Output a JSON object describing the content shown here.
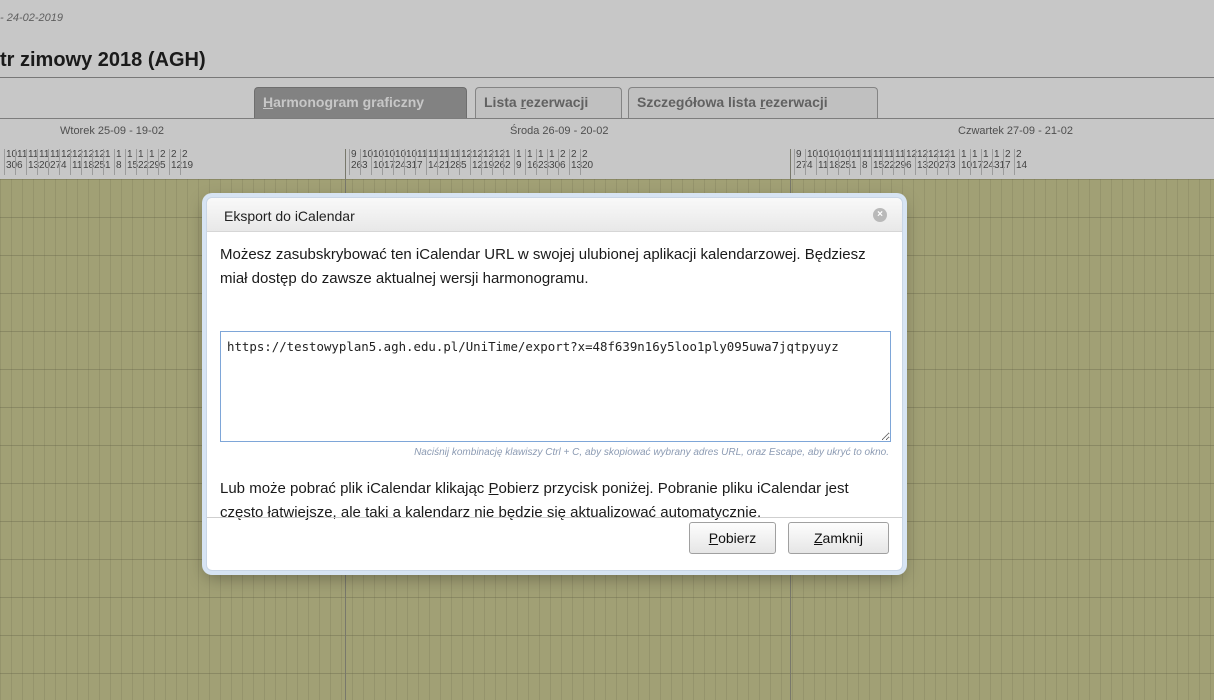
{
  "page": {
    "date_range": "- 24-02-2019",
    "title": "tr zimowy 2018 (AGH)"
  },
  "tabs": [
    {
      "accel": "H",
      "rest": "armonogram graficzny",
      "active": true
    },
    {
      "pre": "Lista ",
      "accel": "r",
      "rest": "ezerwacji",
      "active": false
    },
    {
      "pre": "Szczegółowa lista ",
      "accel": "r",
      "rest": "ezerwacji",
      "active": false
    }
  ],
  "calendar": {
    "days": [
      "Wtorek 25-09 - 19-02",
      "Środa 26-09 - 20-02",
      "Czwartek 27-09 - 21-02"
    ],
    "ticks": [
      [
        [
          "10",
          "30"
        ],
        [
          "11",
          "6"
        ],
        [
          "11",
          "13"
        ],
        [
          "11",
          "20"
        ],
        [
          "11",
          "27"
        ],
        [
          "12",
          "4"
        ],
        [
          "12",
          "11"
        ],
        [
          "12",
          "18"
        ],
        [
          "12",
          "25"
        ],
        [
          "1",
          "1"
        ],
        [
          "1",
          "8"
        ],
        [
          "1",
          "15"
        ],
        [
          "1",
          "22"
        ],
        [
          "1",
          "29"
        ],
        [
          "2",
          "5"
        ],
        [
          "2",
          "12"
        ],
        [
          "2",
          "19"
        ]
      ],
      [
        [
          "9",
          "26"
        ],
        [
          "10",
          "3"
        ],
        [
          "10",
          "10"
        ],
        [
          "10",
          "17"
        ],
        [
          "10",
          "24"
        ],
        [
          "10",
          "31"
        ],
        [
          "11",
          "7"
        ],
        [
          "11",
          "14"
        ],
        [
          "11",
          "21"
        ],
        [
          "11",
          "28"
        ],
        [
          "12",
          "5"
        ],
        [
          "12",
          "12"
        ],
        [
          "12",
          "19"
        ],
        [
          "12",
          "26"
        ],
        [
          "1",
          "2"
        ],
        [
          "1",
          "9"
        ],
        [
          "1",
          "16"
        ],
        [
          "1",
          "23"
        ],
        [
          "1",
          "30"
        ],
        [
          "2",
          "6"
        ],
        [
          "2",
          "13"
        ],
        [
          "2",
          "20"
        ]
      ],
      [
        [
          "9",
          "27"
        ],
        [
          "10",
          "4"
        ],
        [
          "10",
          "11"
        ],
        [
          "10",
          "18"
        ],
        [
          "10",
          "25"
        ],
        [
          "11",
          "1"
        ],
        [
          "11",
          "8"
        ],
        [
          "11",
          "15"
        ],
        [
          "11",
          "22"
        ],
        [
          "11",
          "29"
        ],
        [
          "12",
          "6"
        ],
        [
          "12",
          "13"
        ],
        [
          "12",
          "20"
        ],
        [
          "12",
          "27"
        ],
        [
          "1",
          "3"
        ],
        [
          "1",
          "10"
        ],
        [
          "1",
          "17"
        ],
        [
          "1",
          "24"
        ],
        [
          "1",
          "31"
        ],
        [
          "2",
          "7"
        ],
        [
          "2",
          "14"
        ]
      ]
    ]
  },
  "dialog": {
    "title": "Eksport do iCalendar",
    "message1": "Możesz zasubskrybować ten iCalendar URL w swojej ulubionej aplikacji kalendarzowej. Będziesz miał dostęp do zawsze aktualnej wersji harmonogramu.",
    "url": "https://testowyplan5.agh.edu.pl/UniTime/export?x=48f639n16y5loo1ply095uwa7jqtpyuyz",
    "hint": "Naciśnij kombinację klawiszy Ctrl + C, aby skopiować wybrany adres URL, oraz Escape, aby ukryć to okno.",
    "message2_part1": "Lub może pobrać plik iCalendar klikając ",
    "message2_accel": "P",
    "message2_rest": "obierz",
    "message2_part2": " przycisk poniżej. Pobranie pliku iCalendar jest często łatwiejsze, ale taki a kalendarz nie będzie się aktualizować automatycznie.",
    "buttons": {
      "download_accel": "P",
      "download_rest": "obierz",
      "close_accel": "Z",
      "close_rest": "amknij"
    }
  }
}
